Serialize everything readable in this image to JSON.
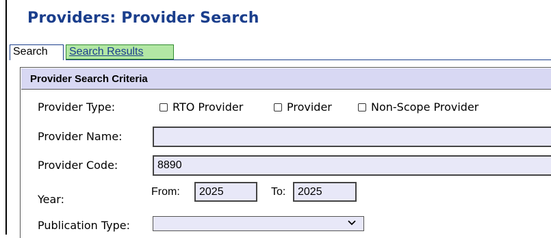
{
  "header": {
    "title": "Providers: Provider Search"
  },
  "tabs": [
    {
      "label": "Search",
      "active": true
    },
    {
      "label": "Search Results",
      "active": false
    }
  ],
  "panel": {
    "header": "Provider Search Criteria"
  },
  "form": {
    "provider_type_label": "Provider Type:",
    "provider_type_options": [
      {
        "label": "RTO Provider",
        "checked": false
      },
      {
        "label": "Provider",
        "checked": false
      },
      {
        "label": "Non-Scope Provider",
        "checked": false
      }
    ],
    "provider_name_label": "Provider Name:",
    "provider_name_value": "",
    "provider_code_label": "Provider Code:",
    "provider_code_value": "8890",
    "year_label": "Year:",
    "year_from_label": "From:",
    "year_from_value": "2025",
    "year_to_label": "To:",
    "year_to_value": "2025",
    "publication_type_label": "Publication Type:",
    "publication_type_value": ""
  },
  "colors": {
    "title": "#1a3e8c",
    "header_bg": "#d8d8f3",
    "results_tab_bg": "#b2e7a4",
    "input_bg": "#e8e8f8"
  },
  "icons": {
    "select_arrow": "chevron-down-icon"
  }
}
